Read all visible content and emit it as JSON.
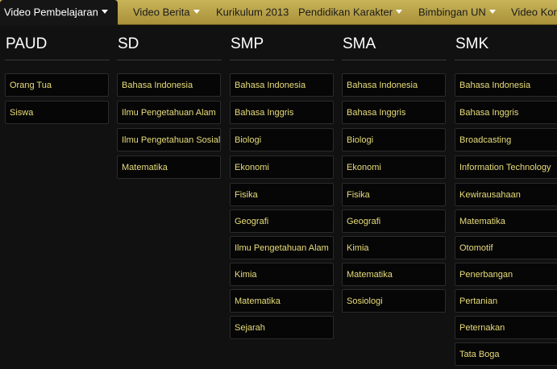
{
  "nav": {
    "items": [
      {
        "label": "Video Pembelajaran",
        "active": true,
        "dropdown": true
      },
      {
        "label": "Video Berita",
        "active": false,
        "dropdown": true
      },
      {
        "label": "Kurikulum 2013",
        "active": false,
        "dropdown": false
      },
      {
        "label": "Pendidikan Karakter",
        "active": false,
        "dropdown": true
      },
      {
        "label": "Bimbingan UN",
        "active": false,
        "dropdown": true
      },
      {
        "label": "Video Kon",
        "active": false,
        "dropdown": false
      }
    ]
  },
  "menu": {
    "columns": [
      {
        "title": "PAUD",
        "items": [
          "Orang Tua",
          "Siswa"
        ]
      },
      {
        "title": "SD",
        "items": [
          "Bahasa Indonesia",
          "Ilmu Pengetahuan Alam",
          "Ilmu Pengetahuan Sosial",
          "Matematika"
        ]
      },
      {
        "title": "SMP",
        "items": [
          "Bahasa Indonesia",
          "Bahasa Inggris",
          "Biologi",
          "Ekonomi",
          "Fisika",
          "Geografi",
          "Ilmu Pengetahuan Alam",
          "Kimia",
          "Matematika",
          "Sejarah"
        ]
      },
      {
        "title": "SMA",
        "items": [
          "Bahasa Indonesia",
          "Bahasa Inggris",
          "Biologi",
          "Ekonomi",
          "Fisika",
          "Geografi",
          "Kimia",
          "Matematika",
          "Sosiologi"
        ]
      },
      {
        "title": "SMK",
        "items": [
          "Bahasa Indonesia",
          "Bahasa Inggris",
          "Broadcasting",
          "Information Technology",
          "Kewirausahaan",
          "Matematika",
          "Otomotif",
          "Penerbangan",
          "Pertanian",
          "Peternakan",
          "Tata Boga"
        ]
      }
    ]
  },
  "colors": {
    "nav_gold": "#c9b45a",
    "item_text": "#e8dd7a",
    "background": "#111111"
  }
}
